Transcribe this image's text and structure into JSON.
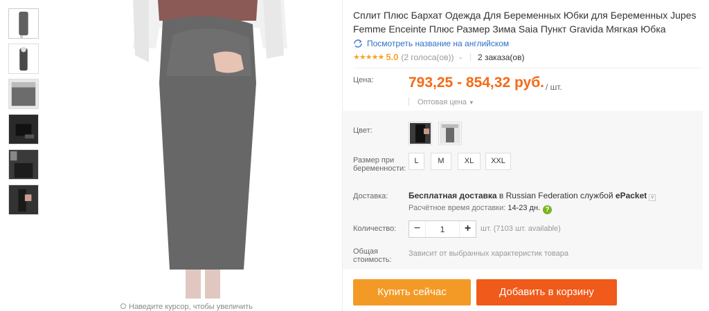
{
  "product": {
    "title": "Сплит Плюс Бархат Одежда Для Беременных Юбки для Беременных Jupes Femme Enceinte Плюс Размер Зима Saia Пункт Gravida Мягкая Юбка",
    "translate_link": "Посмотреть название на английском",
    "rating": {
      "stars": 5,
      "value": "5.0",
      "votes": "(2 голоса(ов))",
      "orders": "2 заказа(ов)"
    }
  },
  "price": {
    "label": "Цена:",
    "value": "793,25 - 854,32 руб.",
    "unit": "/ шт.",
    "wholesale": "Оптовая цена"
  },
  "options": {
    "color_label": "Цвет:",
    "size_label": "Размер при беременности:",
    "sizes": [
      "L",
      "M",
      "XL",
      "XXL"
    ]
  },
  "delivery": {
    "label": "Доставка:",
    "free_text": "Бесплатная доставка",
    "country_text": " в Russian Federation службой ",
    "service": "ePacket",
    "estimate_label": "Расчётное время доставки: ",
    "estimate_days": "14-23 дн."
  },
  "quantity": {
    "label": "Количество:",
    "value": "1",
    "available": "шт. (7103 шт. available)"
  },
  "total": {
    "label": "Общая стоимость:",
    "value": "Зависит от выбранных характеристик товара"
  },
  "buttons": {
    "buy_now": "Купить сейчас",
    "add_to_cart": "Добавить в корзину"
  },
  "gallery": {
    "zoom_hint": "Наведите курсор, чтобы увеличить"
  },
  "colors": {
    "price": "#f46a17",
    "buy_button": "#f39a26",
    "cart_button": "#f05a1a",
    "link": "#2c6ec6",
    "stars": "#f5a623"
  }
}
